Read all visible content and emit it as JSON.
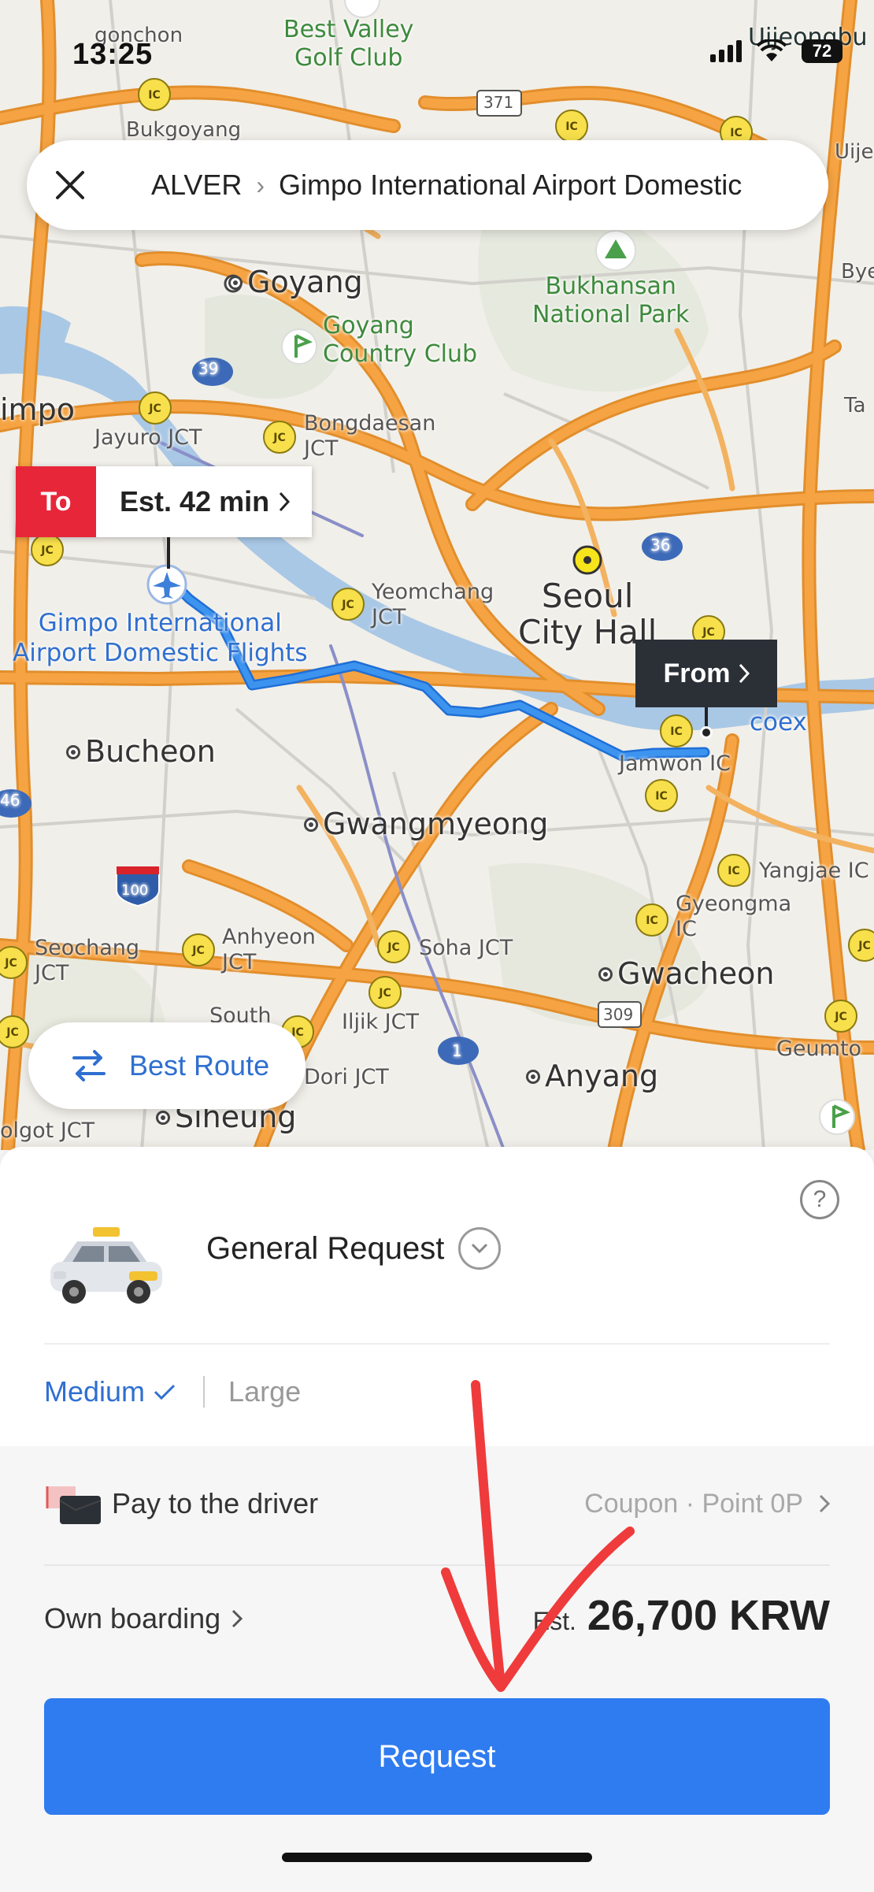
{
  "status_bar": {
    "time": "13:25",
    "battery": "72"
  },
  "route_header": {
    "origin": "ALVER",
    "separator": "›",
    "destination": "Gimpo International Airport Domestic"
  },
  "map": {
    "to_marker": {
      "tag": "To",
      "eta": "Est. 42 min"
    },
    "from_marker": {
      "label": "From"
    },
    "labels": {
      "best_valley": "Best Valley\nGolf Club",
      "goyang": "Goyang",
      "goyang_cc": "Goyang\nCountry Club",
      "bukhansan": "Bukhansan\nNational Park",
      "gimpo_left": "impo",
      "jayuro": "Jayuro JCT",
      "bongdaesan": "Bongdaesan\nJCT",
      "yeomchang": "Yeomchang\nJCT",
      "seoul": "Seoul\nCity Hall",
      "gimpo_airport": "Gimpo International\nAirport Domestic Flights",
      "bucheon": "Bucheon",
      "gwangmyeong": "Gwangmyeong",
      "jamwon": "Jamwon IC",
      "coex": "coex",
      "yangjae": "Yangjae IC",
      "gyeongma": "Gyeongma\nIC",
      "gwacheon": "Gwacheon",
      "seochang": "Seochang\nJCT",
      "anhyeon": "Anhyeon\nJCT",
      "soha": "Soha JCT",
      "south": "South",
      "iljik": "Iljik JCT",
      "dori": "Dori JCT",
      "anyang": "Anyang",
      "siheung": "Siheung",
      "volgot": "olgot JCT",
      "geumto": "Geumto",
      "bukgoyang": "Bukgoyang",
      "gonchon": "gonchon",
      "uijeongbu": "Uijeongbu",
      "uije": "Uije",
      "bye": "Bye",
      "ta": "Ta",
      "road_371": "371",
      "road_39": "39",
      "road_36": "36",
      "road_46": "46",
      "road_100": "100",
      "road_309": "309",
      "road_1": "1"
    },
    "best_route_label": "Best Route"
  },
  "sheet": {
    "help": "?",
    "request_type": "General Request",
    "sizes": {
      "medium": "Medium",
      "large": "Large"
    },
    "payment": {
      "label": "Pay to the driver",
      "coupon": "Coupon · Point 0P"
    },
    "boarding": "Own boarding",
    "fare": {
      "est": "Est.",
      "amount": "26,700 KRW"
    },
    "request_button": "Request"
  },
  "colors": {
    "accent_blue": "#2f7bf0",
    "to_red": "#e8263a",
    "from_dark": "#2b2f36",
    "route_blue": "#3a8ee6",
    "annotation_red": "#ef3b3b"
  },
  "icons": {
    "close": "close-icon",
    "route": "route-icon",
    "chevron": "chevron-down-icon",
    "check": "check-icon",
    "wallet": "wallet-icon",
    "taxi": "taxi-icon",
    "help": "help-icon",
    "airplane": "airplane-icon"
  }
}
